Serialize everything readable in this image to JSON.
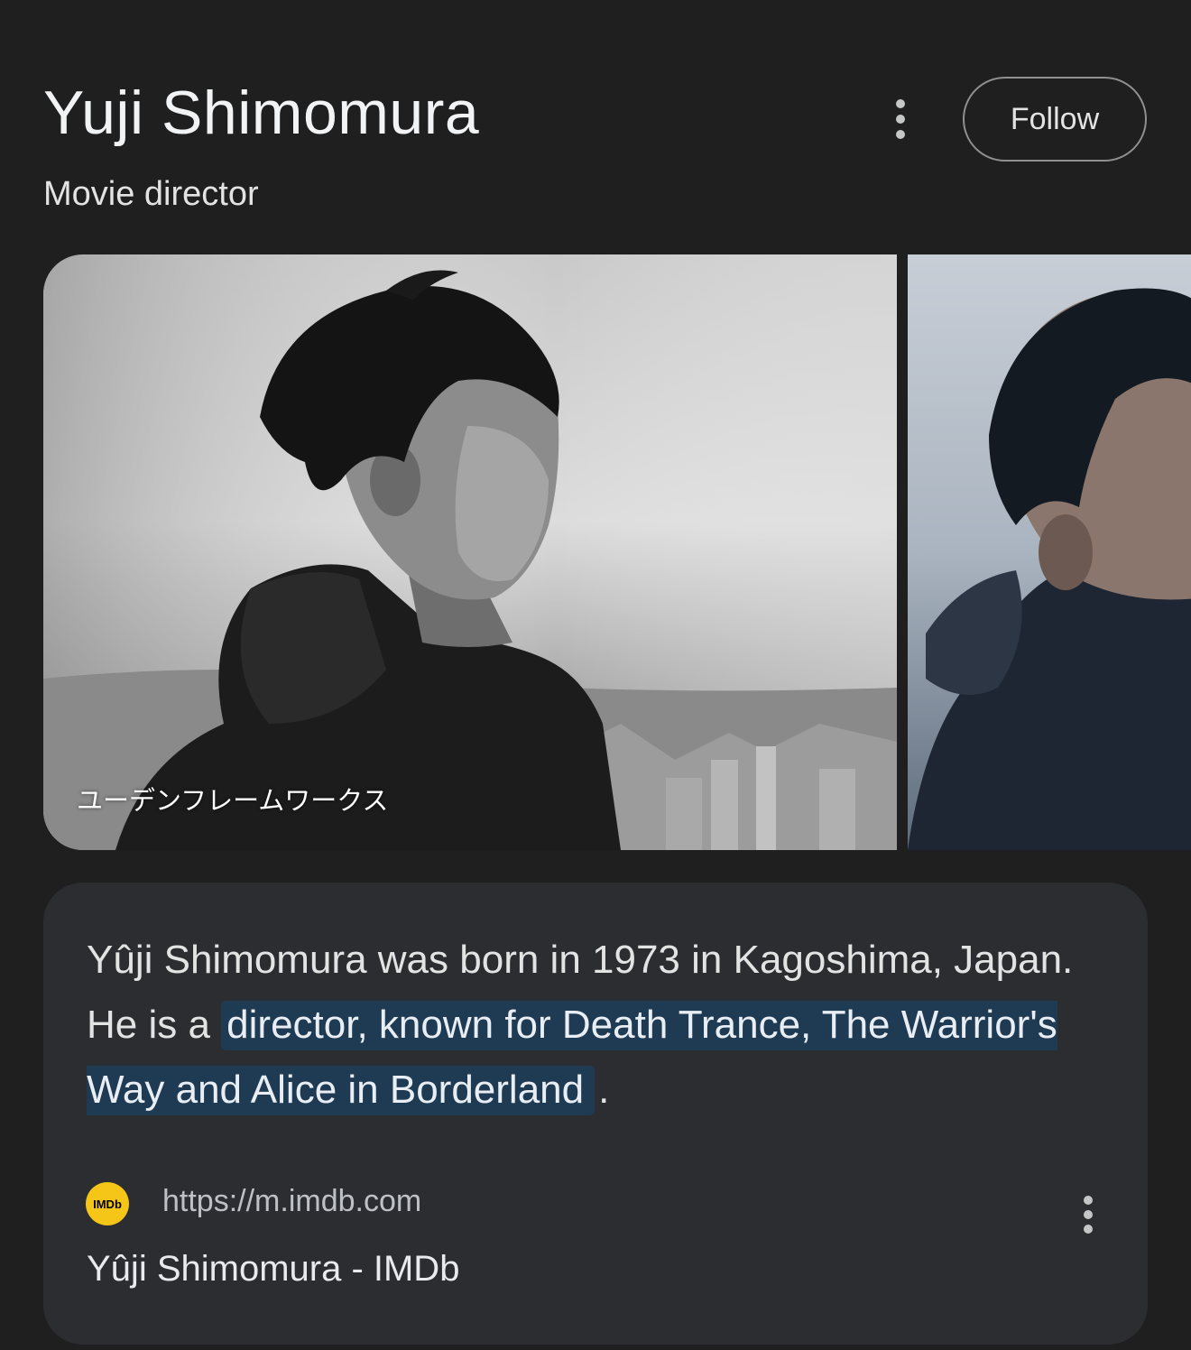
{
  "entity": {
    "name": "Yuji Shimomura",
    "subtitle": "Movie director",
    "follow_label": "Follow",
    "more_icon": "more-vert-icon"
  },
  "gallery": {
    "images": [
      {
        "caption": "ユーデンフレームワークス",
        "style": "grayscale portrait"
      },
      {
        "caption": "",
        "style": "color portrait"
      }
    ]
  },
  "description": {
    "text_before": "Yûji Shimomura was born in 1973 in Kagoshima, Japan. He is a ",
    "highlight": "director, known for Death Trance, The Warrior's Way and Alice in Borderland",
    "text_after": ".",
    "highlight_color": "#1f3b54"
  },
  "source": {
    "logo_text": "IMDb",
    "logo_color": "#f5c518",
    "url": "https://m.imdb.com",
    "title": "Yûji Shimomura - IMDb",
    "more_icon": "more-vert-icon"
  }
}
